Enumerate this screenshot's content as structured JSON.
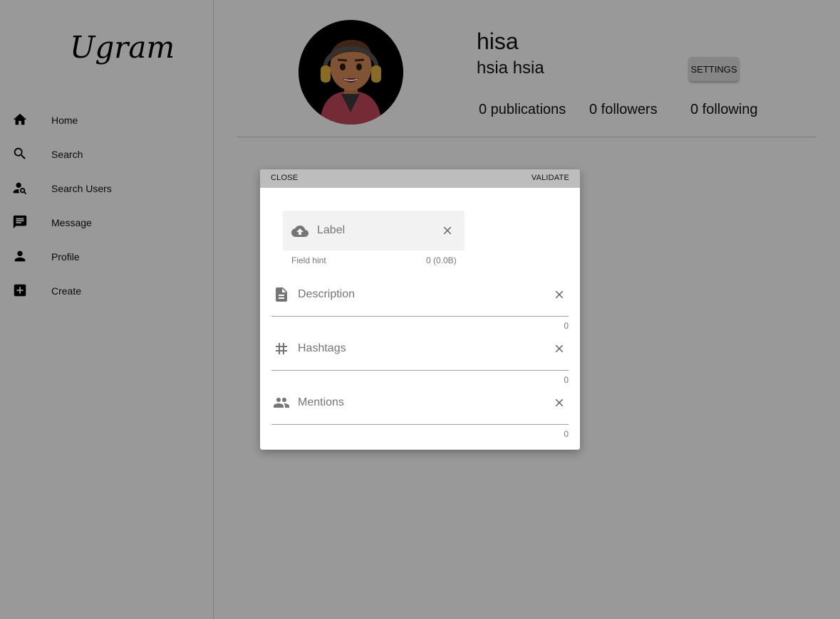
{
  "app": {
    "logo": "Ugram"
  },
  "sidebar": {
    "items": [
      {
        "label": "Home",
        "icon": "home-icon"
      },
      {
        "label": "Search",
        "icon": "search-icon"
      },
      {
        "label": "Search Users",
        "icon": "person-search-icon"
      },
      {
        "label": "Message",
        "icon": "message-icon"
      },
      {
        "label": "Profile",
        "icon": "person-icon"
      },
      {
        "label": "Create",
        "icon": "add-box-icon"
      }
    ]
  },
  "profile": {
    "username": "hisa",
    "fullname": "hsia hsia",
    "settings_label": "SETTINGS",
    "publications": "0 publications",
    "followers": "0 followers",
    "following": "0 following"
  },
  "dialog": {
    "close_label": "CLOSE",
    "validate_label": "VALIDATE",
    "file_field": {
      "label": "Label",
      "hint": "Field hint",
      "size": "0 (0.0B)",
      "icon": "cloud-upload-icon"
    },
    "description": {
      "label": "Description",
      "counter": "0",
      "icon": "description-icon"
    },
    "hashtags": {
      "label": "Hashtags",
      "counter": "0",
      "icon": "hashtag-icon"
    },
    "mentions": {
      "label": "Mentions",
      "counter": "0",
      "icon": "people-icon"
    }
  },
  "colors": {
    "overlay": "#000000",
    "dialog_bar": "#bdbdbd",
    "file_field_bg": "#f2f2f2",
    "avatar_bg": "#000000"
  }
}
